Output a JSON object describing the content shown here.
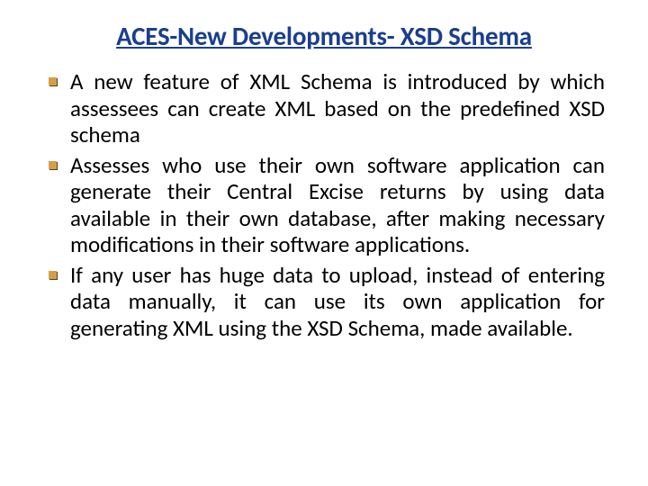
{
  "title": "ACES-New Developments- XSD Schema",
  "bullets": [
    "A new feature of XML Schema is introduced by which assessees can create XML based on the predefined XSD schema",
    "Assesses who use their own software application can generate their Central Excise returns by using data available in their own database, after making necessary modifications in their software applications.",
    "If any user has huge data to upload, instead of entering data manually, it can use its own application for generating XML using the XSD Schema, made available."
  ]
}
